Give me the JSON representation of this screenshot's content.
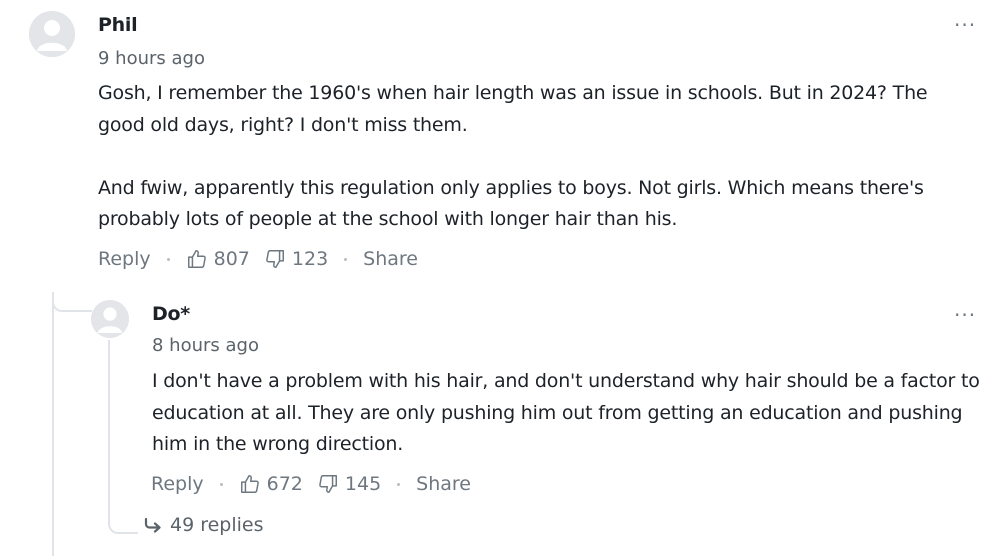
{
  "comments": [
    {
      "author": "Phil",
      "time": "9 hours ago",
      "paragraphs": [
        "Gosh, I remember the 1960's when hair length was an issue in schools. But in 2024? The good old days, right? I don't miss them.",
        "And fwiw, apparently this regulation only applies to boys. Not girls. Which means there's probably lots of people at the school with longer hair than his."
      ],
      "reply_label": "Reply",
      "upvotes": "807",
      "downvotes": "123",
      "share_label": "Share",
      "more_label": "···"
    },
    {
      "author": "Do*",
      "time": "8 hours ago",
      "paragraphs": [
        "I don't have a problem with his hair, and don't understand why hair should be a factor to education at all.  They are only pushing him out from getting an education and pushing him in the wrong direction."
      ],
      "reply_label": "Reply",
      "upvotes": "672",
      "downvotes": "145",
      "share_label": "Share",
      "more_label": "···",
      "replies_label": "49 replies"
    }
  ],
  "icons": {
    "avatar": "user-silhouette-icon",
    "more": "more-options-icon",
    "upvote": "thumbs-up-icon",
    "downvote": "thumbs-down-icon",
    "replies": "reply-arrow-icon"
  },
  "colors": {
    "text": "#1d2228",
    "muted": "#6e7780",
    "avatar_bg": "#e3e5e8",
    "thread_line": "#e0e4e9"
  }
}
